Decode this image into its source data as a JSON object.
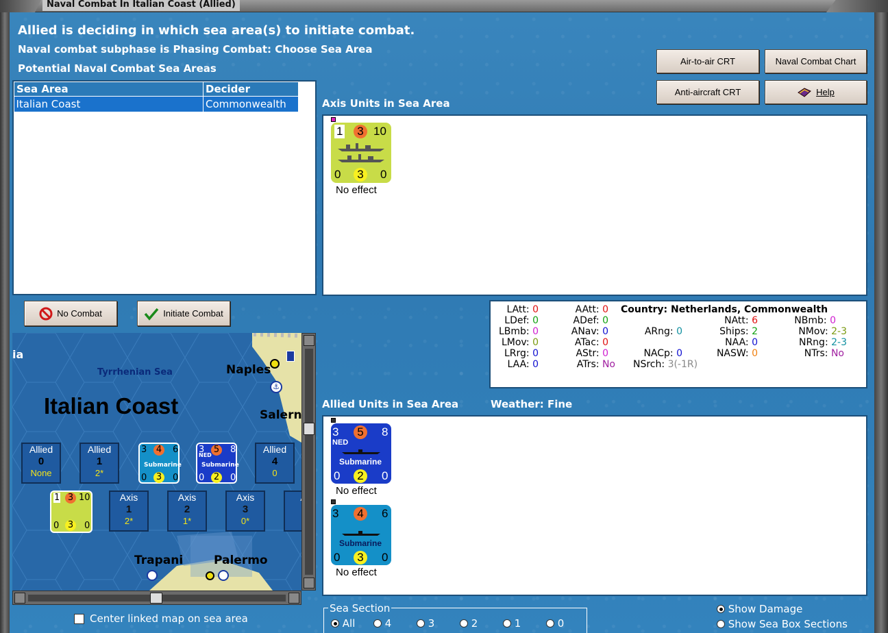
{
  "window": {
    "title": "Naval Combat In Italian Coast (Allied)"
  },
  "headers": {
    "line1": "Allied is deciding in which sea area(s) to initiate combat.",
    "line2": "Naval combat subphase is Phasing Combat: Choose Sea Area",
    "line3": "Potential Naval Combat Sea Areas"
  },
  "buttons": {
    "air_to_air": "Air-to-air CRT",
    "naval_chart": "Naval Combat Chart",
    "anti_aircraft": "Anti-aircraft CRT",
    "help": "Help",
    "no_combat": "No Combat",
    "initiate_combat": "Initiate Combat"
  },
  "sea_table": {
    "columns": [
      "Sea Area",
      "Decider"
    ],
    "rows": [
      [
        "Italian Coast",
        "Commonwealth"
      ]
    ]
  },
  "axis_units": {
    "label": "Axis Units in Sea Area",
    "counter": {
      "tl": "1",
      "tm": "3",
      "tr": "10",
      "bl": "0",
      "bm": "3",
      "br": "0"
    },
    "effect": "No effect"
  },
  "stats": {
    "country": "Country: Netherlands, Commonwealth",
    "items": [
      {
        "k": "LAtt:",
        "v": "0",
        "c": "#e01010"
      },
      {
        "k": "LDef:",
        "v": "0",
        "c": "#10a010"
      },
      {
        "k": "LBmb:",
        "v": "0",
        "c": "#d020d0"
      },
      {
        "k": "LMov:",
        "v": "0",
        "c": "#7a9a10"
      },
      {
        "k": "LRrg:",
        "v": "0",
        "c": "#1010d0"
      },
      {
        "k": "LAA:",
        "v": "0",
        "c": "#1010d0"
      },
      {
        "k": "AAtt:",
        "v": "0",
        "c": "#e01010"
      },
      {
        "k": "ADef:",
        "v": "0",
        "c": "#10a010"
      },
      {
        "k": "ANav:",
        "v": "0",
        "c": "#1010d0"
      },
      {
        "k": "ATac:",
        "v": "0",
        "c": "#e01010"
      },
      {
        "k": "AStr:",
        "v": "0",
        "c": "#d020d0"
      },
      {
        "k": "ATrs:",
        "v": "No",
        "c": "#a020a0"
      },
      {
        "k": "ARng:",
        "v": "0",
        "c": "#1090a0"
      },
      {
        "k": "NACp:",
        "v": "0",
        "c": "#1010d0"
      },
      {
        "k": "NSrch:",
        "v": "3(-1R)",
        "c": "#888888"
      },
      {
        "k": "NAtt:",
        "v": "6",
        "c": "#e01010"
      },
      {
        "k": "Ships:",
        "v": "2",
        "c": "#10a010"
      },
      {
        "k": "NAA:",
        "v": "0",
        "c": "#1010d0"
      },
      {
        "k": "NASW:",
        "v": "0",
        "c": "#f08010"
      },
      {
        "k": "NBmb:",
        "v": "0",
        "c": "#d020d0"
      },
      {
        "k": "NMov:",
        "v": "2-3",
        "c": "#7a9a10"
      },
      {
        "k": "NRng:",
        "v": "2-3",
        "c": "#1090a0"
      },
      {
        "k": "NTrs:",
        "v": "No",
        "c": "#a020a0"
      }
    ]
  },
  "allied_units": {
    "label": "Allied Units in Sea Area",
    "weather": "Weather:  Fine",
    "counters": [
      {
        "tl": "3",
        "tm": "5",
        "tr": "8",
        "nation": "NED",
        "type": "Submarine",
        "bl": "0",
        "bm": "2",
        "br": "0",
        "effect": "No effect"
      },
      {
        "tl": "3",
        "tm": "4",
        "tr": "6",
        "nation": "",
        "type": "Submarine",
        "bl": "0",
        "bm": "3",
        "br": "0",
        "effect": "No effect"
      }
    ]
  },
  "map": {
    "region_label": "ia",
    "sea_label": "Tyrrhenian Sea",
    "area_title": "Italian Coast",
    "cities": [
      "Naples",
      "Salern",
      "Trapani",
      "Palermo"
    ],
    "allied_boxes": [
      {
        "side": "Allied",
        "num": "0",
        "sub": "None"
      },
      {
        "side": "Allied",
        "num": "1",
        "sub": "2*"
      },
      {
        "side": "Allied",
        "num": "4",
        "sub": "0"
      }
    ],
    "axis_boxes": [
      {
        "side": "Axis",
        "num": "1",
        "sub": "2*"
      },
      {
        "side": "Axis",
        "num": "2",
        "sub": "1*"
      },
      {
        "side": "Axis",
        "num": "3",
        "sub": "0*"
      },
      {
        "side": "A",
        "num": "",
        "sub": ""
      }
    ],
    "counter_sub": "Submarine",
    "ned_label": "NED"
  },
  "options": {
    "center_map": "Center linked map on sea area",
    "sea_section_label": "Sea Section",
    "sections": [
      "All",
      "4",
      "3",
      "2",
      "1",
      "0"
    ],
    "show_damage": "Show Damage",
    "show_boxes": "Show Sea Box Sections"
  }
}
